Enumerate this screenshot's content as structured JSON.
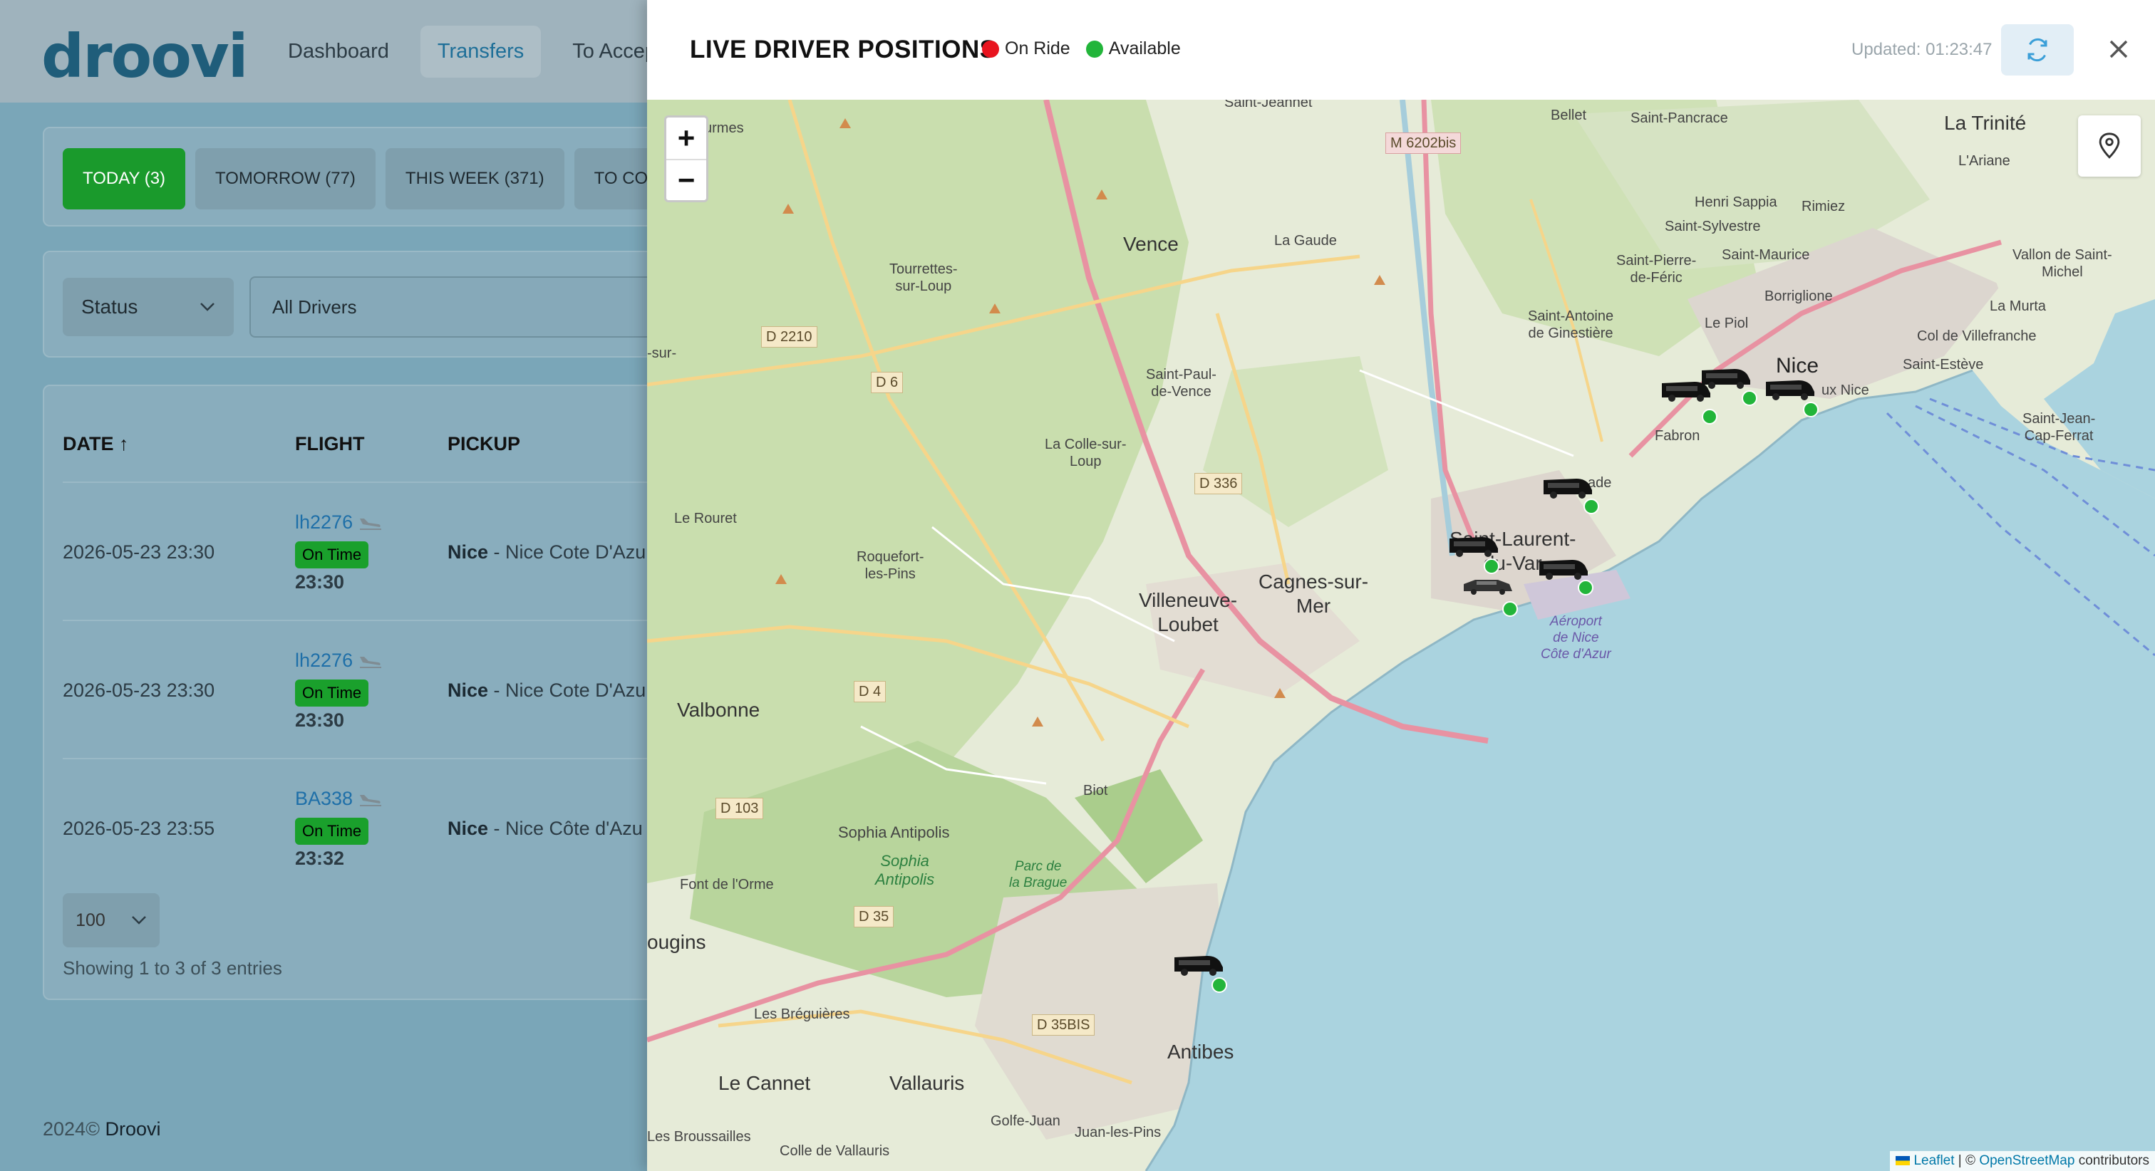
{
  "app": {
    "logo": "droovi",
    "nav": [
      "Dashboard",
      "Transfers",
      "To Accep"
    ],
    "active_nav": "Transfers"
  },
  "tabs": [
    "TODAY (3)",
    "TOMORROW (77)",
    "THIS WEEK (371)",
    "TO COM"
  ],
  "filters": {
    "status": "Status",
    "drivers": "All Drivers"
  },
  "table": {
    "headers": {
      "date": "DATE ↑",
      "flight": "FLIGHT",
      "pickup": "PICKUP"
    },
    "rows": [
      {
        "date": "2026-05-23 23:30",
        "flight": "lh2276",
        "status": "On Time",
        "time": "23:30",
        "pickup_city": "Nice",
        "pickup_place": " - Nice Cote D'Azu"
      },
      {
        "date": "2026-05-23 23:30",
        "flight": "lh2276",
        "status": "On Time",
        "time": "23:30",
        "pickup_city": "Nice",
        "pickup_place": " - Nice Cote D'Azu"
      },
      {
        "date": "2026-05-23 23:55",
        "flight": "BA338",
        "status": "On Time",
        "time": "23:32",
        "pickup_city": "Nice",
        "pickup_place": " - Nice Côte d'Azu"
      }
    ],
    "page_size": "100",
    "entries": "Showing 1 to 3 of 3 entries"
  },
  "footer": {
    "year": "2024©",
    "brand": "Droovi"
  },
  "modal": {
    "title": "LIVE DRIVER POSITIONS",
    "legend": [
      {
        "label": "On Ride",
        "color": "#e8141f"
      },
      {
        "label": "Available",
        "color": "#22b53a"
      }
    ],
    "updated": "Updated: 01:23:47",
    "zoom_in": "+",
    "zoom_out": "−",
    "attribution": {
      "leaflet": "Leaflet",
      "sep": " | © ",
      "osm": "OpenStreetMap",
      "tail": " contributors"
    }
  },
  "map_labels": {
    "saint_jeannet": "Saint-Jeannet",
    "urmes": "urmes",
    "m6202": "M 6202bis",
    "bellet": "Bellet",
    "saint_pancrace": "Saint-Pancrace",
    "la_trinite": "La Trinité",
    "l_ariane": "L'Ariane",
    "henri_sappia": "Henri Sappia",
    "rimiez": "Rimiez",
    "saint_sylvestre": "Saint-Sylvestre",
    "vallon": "Vallon de Saint-\nMichel",
    "vence": "Vence",
    "la_gaude": "La Gaude",
    "saint_pierre": "Saint-Pierre-\nde-Féric",
    "saint_maurice": "Saint-Maurice",
    "borriglione": "Borriglione",
    "la_murta": "La Murta",
    "tourrettes": "Tourrettes-\nsur-Loup",
    "saint_antoine": "Saint-Antoine\nde Ginestière",
    "le_piol": "Le Piol",
    "col_villefranche": "Col de Villefranche",
    "d2210": "D 2210",
    "nice": "Nice",
    "saint_esteve": "Saint-Estève",
    "sur": "-sur-",
    "d6": "D 6",
    "saint_paul": "Saint-Paul-\nde-Vence",
    "lux_nice": "ux Nice",
    "saint_jean": "Saint-Jean-\nCap-Ferrat",
    "fabron": "Fabron",
    "la_colle": "La Colle-sur-\nLoup",
    "d336": "D 336",
    "ade": "ade",
    "le_rouret": "Le Rouret",
    "saint_laurent": "Saint-Laurent-\ndu-Var",
    "roquefort": "Roquefort-\nles-Pins",
    "cagnes": "Cagnes-sur-\nMer",
    "villeneuve": "Villeneuve-\nLoubet",
    "aeroport": "Aéroport\nde Nice\nCôte d'Azur",
    "valbonne": "Valbonne",
    "d4": "D 4",
    "biot": "Biot",
    "d103": "D 103",
    "sophia": "Sophia Antipolis",
    "sophia_park": "Sophia\nAntipolis",
    "parc_brague": "Parc de\nla Brague",
    "fort_orme": "Font de l'Orme",
    "d35": "D 35",
    "ougins": "ougins",
    "bregueres": "Les Bréguières",
    "d35bis": "D 35BIS",
    "antibes": "Antibes",
    "le_cannet": "Le Cannet",
    "vallauris": "Vallauris",
    "golfe_juan": "Golfe-Juan",
    "juan_pins": "Juan-les-Pins",
    "broussailles": "Les Broussailles",
    "colle_vallauris": "Colle de Vallauris"
  }
}
